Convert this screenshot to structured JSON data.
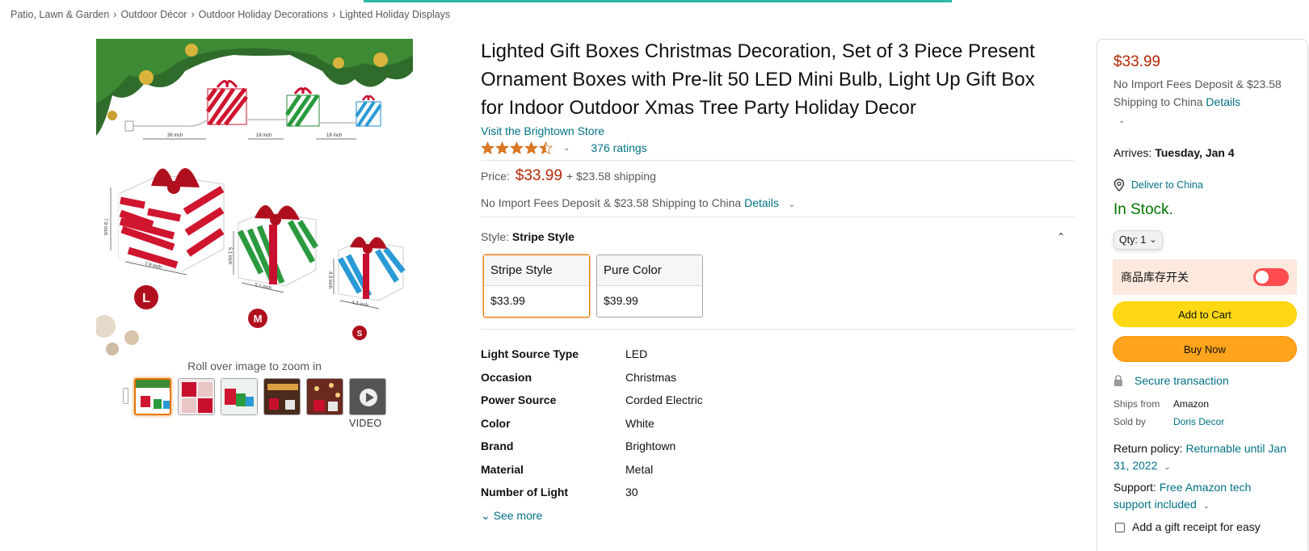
{
  "breadcrumb": [
    "Patio, Lawn & Garden",
    "Outdoor Décor",
    "Outdoor Holiday Decorations",
    "Lighted Holiday Displays"
  ],
  "breadcrumb_sep": "›",
  "gallery": {
    "zoom_hint": "Roll over image to zoom in",
    "video_label": "VIDEO",
    "image_labels": {
      "dim1": "36 inch",
      "dim2": "18 inch",
      "dim3": "18 inch",
      "large_w": "7.9 inch",
      "large_h": "7.9 inch",
      "med_w": "5.1 inch",
      "med_h": "5.1 inch",
      "small_w": "4.3 inch",
      "small_h": "4.3 inch",
      "size_l": "L",
      "size_m": "M",
      "size_s": "S"
    }
  },
  "product": {
    "title": "Lighted Gift Boxes Christmas Decoration, Set of 3 Piece Present Ornament Boxes with Pre-lit 50 LED Mini Bulb, Light Up Gift Box for Indoor Outdoor Xmas Tree Party Holiday Decor",
    "store_link": "Visit the Brightown Store",
    "rating_stars": 4.5,
    "ratings_count": "376 ratings",
    "price_label": "Price:",
    "price": "$33.99",
    "shipping": "+ $23.58 shipping",
    "import_text": "No Import Fees Deposit & $23.58 Shipping to China",
    "details_link": "Details",
    "style_label": "Style:",
    "style_selected": "Stripe Style",
    "styles": [
      {
        "name": "Stripe Style",
        "price": "$33.99"
      },
      {
        "name": "Pure Color",
        "price": "$39.99"
      }
    ],
    "specs": [
      {
        "k": "Light Source Type",
        "v": "LED"
      },
      {
        "k": "Occasion",
        "v": "Christmas"
      },
      {
        "k": "Power Source",
        "v": "Corded Electric"
      },
      {
        "k": "Color",
        "v": "White"
      },
      {
        "k": "Brand",
        "v": "Brightown"
      },
      {
        "k": "Material",
        "v": "Metal"
      },
      {
        "k": "Number of Light",
        "v": "30"
      }
    ],
    "see_more": "See more"
  },
  "buybox": {
    "price": "$33.99",
    "import_text": "No Import Fees Deposit & $23.58 Shipping to China",
    "details_link": "Details",
    "arrives_label": "Arrives:",
    "arrives_date": "Tuesday, Jan 4",
    "deliver_to": "Deliver to China",
    "stock": "In Stock.",
    "qty_label": "Qty:",
    "qty_value": "1",
    "toggle_label": "商品库存开关",
    "add_to_cart": "Add to Cart",
    "buy_now": "Buy Now",
    "secure": "Secure transaction",
    "ships_from_label": "Ships from",
    "ships_from": "Amazon",
    "sold_by_label": "Sold by",
    "sold_by": "Doris Decor",
    "return_label": "Return policy:",
    "return_link": "Returnable until Jan 31, 2022",
    "support_label": "Support:",
    "support_link": "Free Amazon tech support included",
    "gift_receipt": "Add a gift receipt for easy"
  },
  "colors": {
    "price_red": "#b12704",
    "link_teal": "#007185",
    "stock_green": "#007600",
    "cart_yellow": "#ffd814",
    "buy_orange": "#ffa41c",
    "toggle_red": "#ff4d4f",
    "toggle_bg": "#fce8dd"
  }
}
